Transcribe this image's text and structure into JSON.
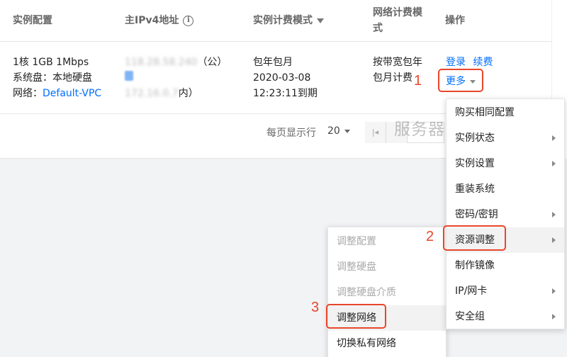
{
  "table": {
    "headers": {
      "config": "实例配置",
      "ip": "主IPv4地址",
      "billing": "实例计费模式",
      "net_billing_line1": "网络计费模",
      "net_billing_line2": "式",
      "actions": "操作"
    },
    "row": {
      "config_line1": "1核 1GB 1Mbps",
      "config_line2": "系统盘：本地硬盘",
      "config_network_label": "网络：",
      "config_network_link": "Default-VPC",
      "public_ip": "118.28.58.240",
      "public_suffix": "（公）",
      "private_ip": "172.16.0.7",
      "private_suffix": "内）",
      "billing_line1": "包年包月",
      "billing_line2": "2020-03-08",
      "billing_line3": "12:23:11到期",
      "net_line1": "按带宽包年",
      "net_line2": "包月计费",
      "action_login": "登录",
      "action_renew": "续费",
      "action_more": "更多"
    }
  },
  "pager": {
    "label": "每页显示行",
    "size": "20",
    "first_icon": "first-page-icon"
  },
  "watermark": "服务器百科",
  "steps": {
    "one": "1",
    "two": "2",
    "three": "3"
  },
  "more_menu": [
    {
      "label": "购买相同配置",
      "submenu": false
    },
    {
      "label": "实例状态",
      "submenu": true
    },
    {
      "label": "实例设置",
      "submenu": true
    },
    {
      "label": "重装系统",
      "submenu": false
    },
    {
      "label": "密码/密钥",
      "submenu": true
    },
    {
      "label": "资源调整",
      "submenu": true
    },
    {
      "label": "制作镜像",
      "submenu": false
    },
    {
      "label": "IP/网卡",
      "submenu": true
    },
    {
      "label": "安全组",
      "submenu": true
    }
  ],
  "resource_submenu": [
    {
      "label": "调整配置",
      "disabled": true
    },
    {
      "label": "调整硬盘",
      "disabled": true
    },
    {
      "label": "调整硬盘介质",
      "disabled": true
    },
    {
      "label": "调整网络",
      "disabled": false
    },
    {
      "label": "切换私有网络",
      "disabled": false
    }
  ],
  "colors": {
    "link": "#006eff",
    "highlight": "#e8462a",
    "background": "#f2f3f5"
  }
}
